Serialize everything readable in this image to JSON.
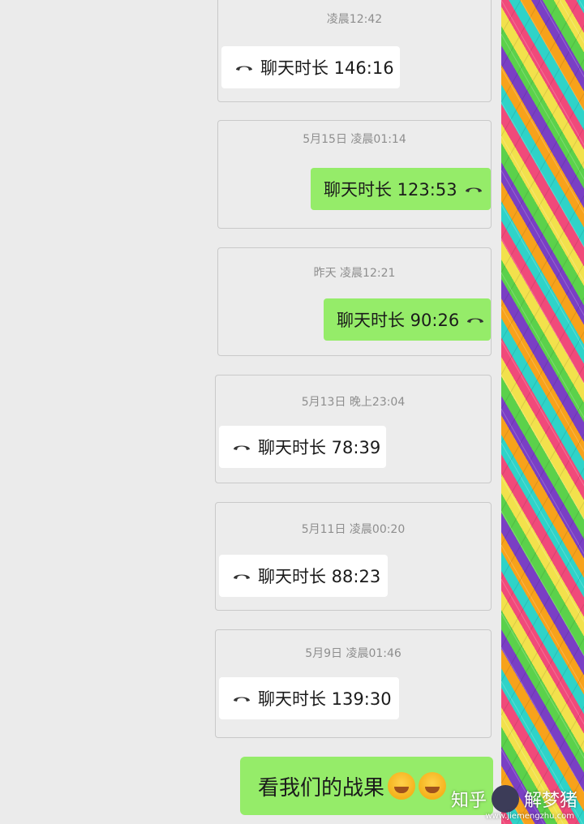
{
  "messages": [
    {
      "time": "凌晨12:42",
      "text": "聊天时长 146:16",
      "side": "left"
    },
    {
      "time": "5月15日 凌晨01:14",
      "text": "聊天时长 123:53",
      "side": "right"
    },
    {
      "time": "昨天 凌晨12:21",
      "text": "聊天时长 90:26",
      "side": "right"
    },
    {
      "time": "5月13日 晚上23:04",
      "text": "聊天时长 78:39",
      "side": "left"
    },
    {
      "time": "5月11日 凌晨00:20",
      "text": "聊天时长 88:23",
      "side": "left"
    },
    {
      "time": "5月9日 凌晨01:46",
      "text": "聊天时长 139:30",
      "side": "left"
    }
  ],
  "final_message": {
    "text": "看我们的战果"
  },
  "watermark": {
    "left": "知乎",
    "right": "解梦猪",
    "url": "www.jiemengzhu.com"
  },
  "icons": {
    "call": "hangup-phone-icon",
    "emoji": "laughing-emoji-icon"
  },
  "colors": {
    "sent_bubble": "#95ec69",
    "received_bubble": "#ffffff",
    "background": "#ebebeb"
  }
}
